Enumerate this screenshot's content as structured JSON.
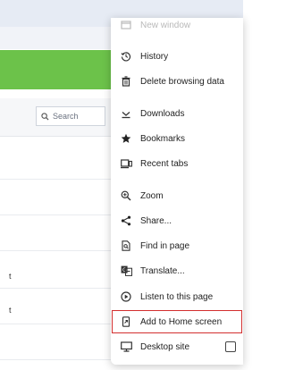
{
  "background": {
    "search_placeholder": "Search",
    "row_texts": [
      "t",
      "t"
    ]
  },
  "menu": {
    "items": [
      {
        "label": "New window",
        "icon": "new-window-icon"
      },
      {
        "label": "History",
        "icon": "history-icon"
      },
      {
        "label": "Delete browsing data",
        "icon": "delete-icon"
      },
      {
        "label": "Downloads",
        "icon": "download-icon"
      },
      {
        "label": "Bookmarks",
        "icon": "star-icon"
      },
      {
        "label": "Recent tabs",
        "icon": "recent-tabs-icon"
      },
      {
        "label": "Zoom",
        "icon": "zoom-icon"
      },
      {
        "label": "Share...",
        "icon": "share-icon"
      },
      {
        "label": "Find in page",
        "icon": "find-in-page-icon"
      },
      {
        "label": "Translate...",
        "icon": "translate-icon"
      },
      {
        "label": "Listen to this page",
        "icon": "listen-icon"
      },
      {
        "label": "Add to Home screen",
        "icon": "add-to-home-icon"
      },
      {
        "label": "Desktop site",
        "icon": "desktop-icon",
        "checked": false
      }
    ]
  },
  "colors": {
    "highlight_outline": "#d32f2f",
    "green_banner": "#6cc24a",
    "top_bar": "#e6ebf4"
  }
}
